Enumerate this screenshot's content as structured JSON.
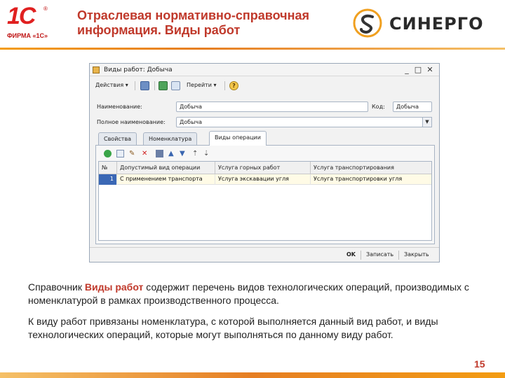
{
  "header": {
    "title_line1": "Отраслевая нормативно-справочная",
    "title_line2": "информация. Виды работ",
    "logo_1c_mark": "1С",
    "logo_1c_reg": "®",
    "logo_1c_firm": "ФИРМА «1С»",
    "logo_synergy_text": "СИНЕРГО"
  },
  "window": {
    "title": "Виды работ: Добыча",
    "controls": [
      "_",
      "□",
      "✕"
    ]
  },
  "toolbar": {
    "actions_label": "Действия",
    "goto_label": "Перейти",
    "help_label": "?"
  },
  "form": {
    "name_label": "Наименование:",
    "name_value": "Добыча",
    "code_label": "Код:",
    "code_value": "Добыча",
    "fullname_label": "Полное наименование:",
    "fullname_value": "Добыча"
  },
  "tabs": [
    {
      "label": "Свойства"
    },
    {
      "label": "Номенклатура"
    },
    {
      "label": "Виды операции"
    }
  ],
  "grid": {
    "columns": [
      "№",
      "Допустимый вид операции",
      "Услуга горных работ",
      "Услуга транспортирования"
    ],
    "rows": [
      {
        "num": "1",
        "operation": "С применением транспорта",
        "mining_service": "Услуга экскавации угля",
        "transport_service": "Услуга транспортировки угля"
      }
    ]
  },
  "bottom_bar": {
    "ok_label": "OK",
    "save_label": "Записать",
    "close_label": "Закрыть"
  },
  "body": {
    "p1_prefix": "Справочник ",
    "p1_highlight": "Виды работ",
    "p1_suffix": " содержит перечень видов технологических операций, производимых с номенклатурой в рамках производственного процесса.",
    "p2": "К виду работ привязаны номенклатура, с которой выполняется данный вид работ, и виды технологических операций, которые могут выполняться по данному виду работ."
  },
  "page_number": "15",
  "colors": {
    "accent_red": "#c0392b",
    "accent_orange": "#e67e22",
    "selection_blue": "#3b68b5"
  }
}
